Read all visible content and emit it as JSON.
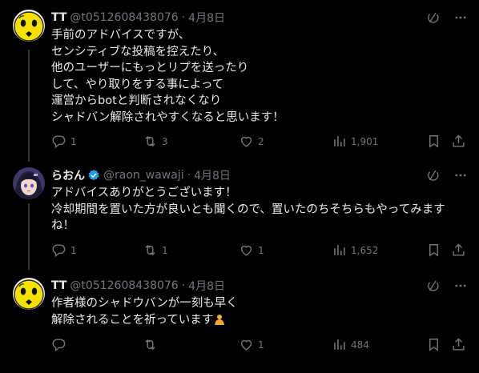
{
  "tweets": [
    {
      "name": "TT",
      "handle": "@t0512608438076",
      "separator": "·",
      "date": "4月8日",
      "avatar": "yellow-smiley-avatar",
      "lines": [
        "手前のアドバイスですが、",
        "センシティブな投稿を控えたり、",
        "他のユーザーにもっとリプを送ったり",
        "して、やり取りをする事によって",
        "運営からbotと判断されなくなり",
        "シャドバン解除されやすくなると思います！"
      ],
      "replies": "1",
      "reposts": "3",
      "likes": "2",
      "views": "1,901"
    },
    {
      "name": "らおん",
      "handle": "@raon_wawaji",
      "separator": "·",
      "date": "4月8日",
      "avatar": "anime-character-avatar",
      "verified": true,
      "lines": [
        "アドバイスありがとうございます！",
        "冷却期間を置いた方が良いとも聞くので、置いたのちそちらもやってみます",
        "ね！"
      ],
      "replies": "1",
      "reposts": "1",
      "likes": "1",
      "views": "1,652"
    },
    {
      "name": "TT",
      "handle": "@t0512608438076",
      "separator": "·",
      "date": "4月8日",
      "avatar": "yellow-smiley-avatar",
      "lines": [
        "作者様のシャドウバンが一刻も早く",
        "解除されることを祈っています"
      ],
      "emoji": "bowing-person-emoji",
      "replies": "",
      "reposts": "",
      "likes": "1",
      "views": "484"
    }
  ],
  "colors": {
    "background": "#000000",
    "text": "#e7e9ea",
    "muted": "#71767b",
    "verified": "#1d9bf0",
    "thread_line": "#333639"
  },
  "icons": [
    "grok-icon",
    "more-icon",
    "reply-icon",
    "repost-icon",
    "like-icon",
    "views-icon",
    "bookmark-icon",
    "share-icon",
    "verified-badge-icon"
  ]
}
